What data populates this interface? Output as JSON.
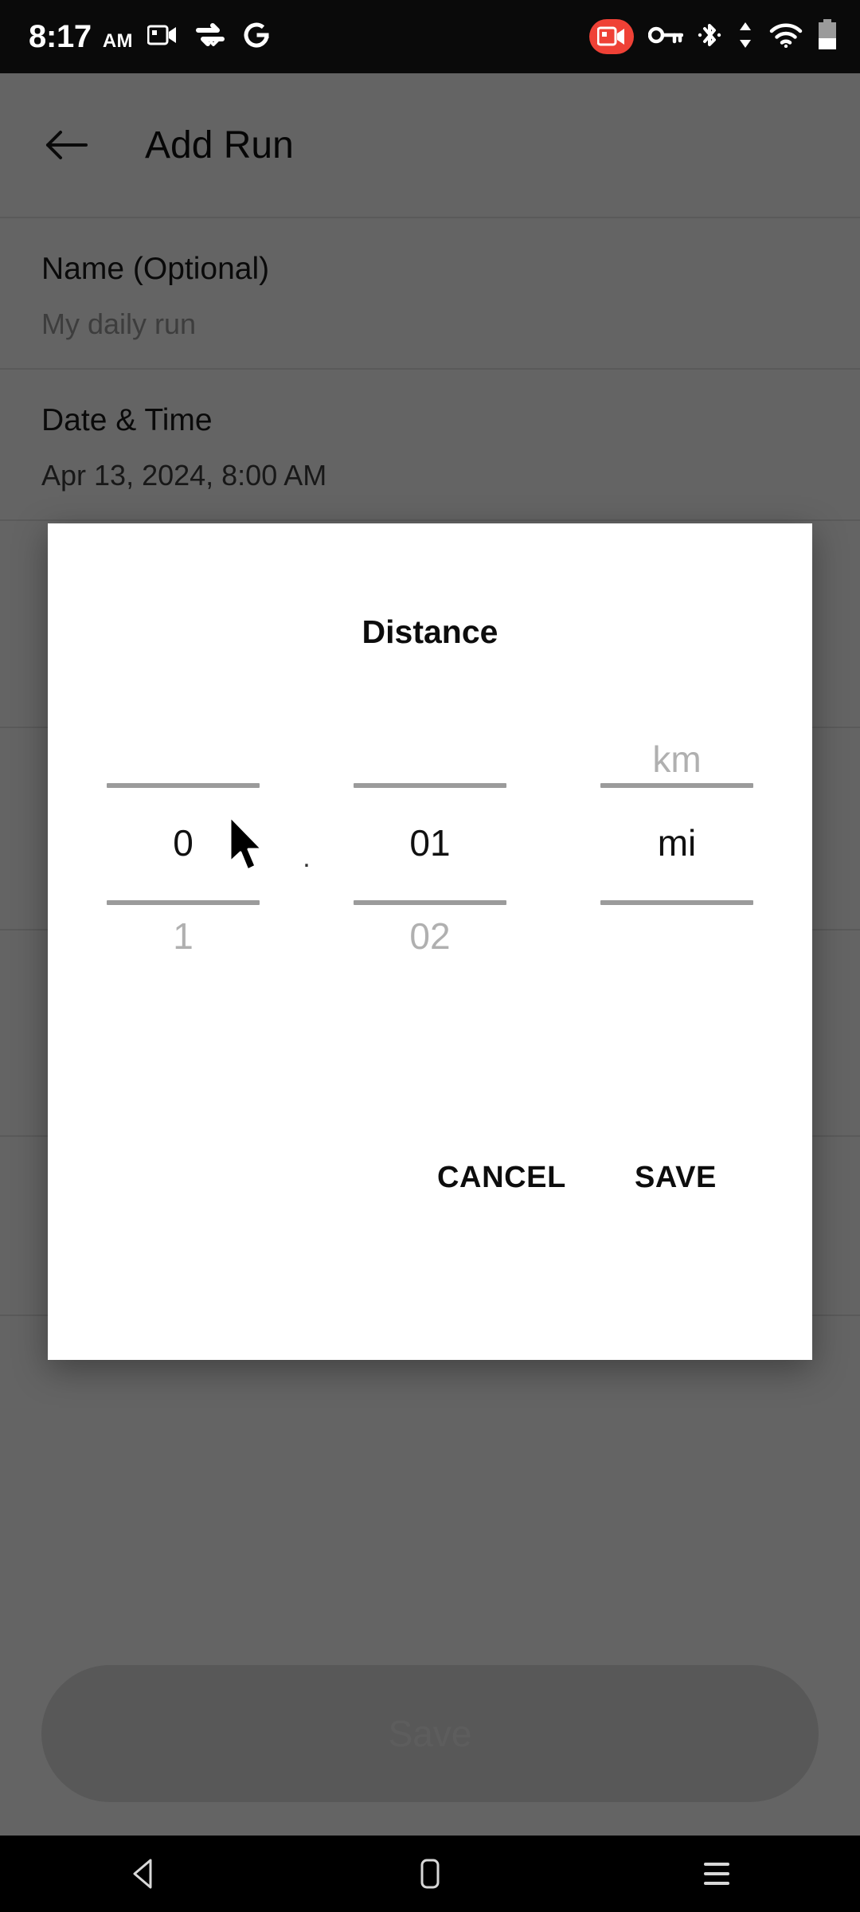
{
  "status_bar": {
    "time": "8:17",
    "ampm": "AM",
    "icons_left": [
      "screen-record-icon",
      "vpn-swap-icon",
      "google-g-icon"
    ],
    "icons_right": [
      "recording-badge-icon",
      "vpn-key-icon",
      "bluetooth-icon",
      "data-transfer-icon",
      "wifi-icon",
      "battery-icon"
    ],
    "recording_badge_color": "#ef4136"
  },
  "app_bar": {
    "back_label": "back-arrow",
    "title": "Add Run"
  },
  "form": {
    "fields": [
      {
        "label": "Name (Optional)",
        "value": "My daily run",
        "value_is_placeholder": true
      },
      {
        "label": "Date & Time",
        "value": "Apr 13, 2024, 8:00 AM",
        "value_is_placeholder": false
      }
    ]
  },
  "bottom_action": {
    "save_label": "Save",
    "disabled": true
  },
  "dialog": {
    "title": "Distance",
    "columns": [
      {
        "name": "whole-number",
        "above": "",
        "current": "0",
        "below": "1"
      },
      {
        "name": "decimal-number",
        "above": "",
        "current": "01",
        "below": "02"
      },
      {
        "name": "unit",
        "above": "km",
        "current": "mi",
        "below": ""
      }
    ],
    "decimal_separator": ".",
    "cancel_label": "CANCEL",
    "save_label": "SAVE"
  },
  "nav_bar": {
    "buttons": [
      "back-nav-icon",
      "home-nav-icon",
      "recents-nav-icon"
    ]
  },
  "colors": {
    "scrim": "#636363",
    "divider": "#e2e2e2",
    "picker_line": "#9b9b9b",
    "accent_text": "#0d0d0d"
  }
}
